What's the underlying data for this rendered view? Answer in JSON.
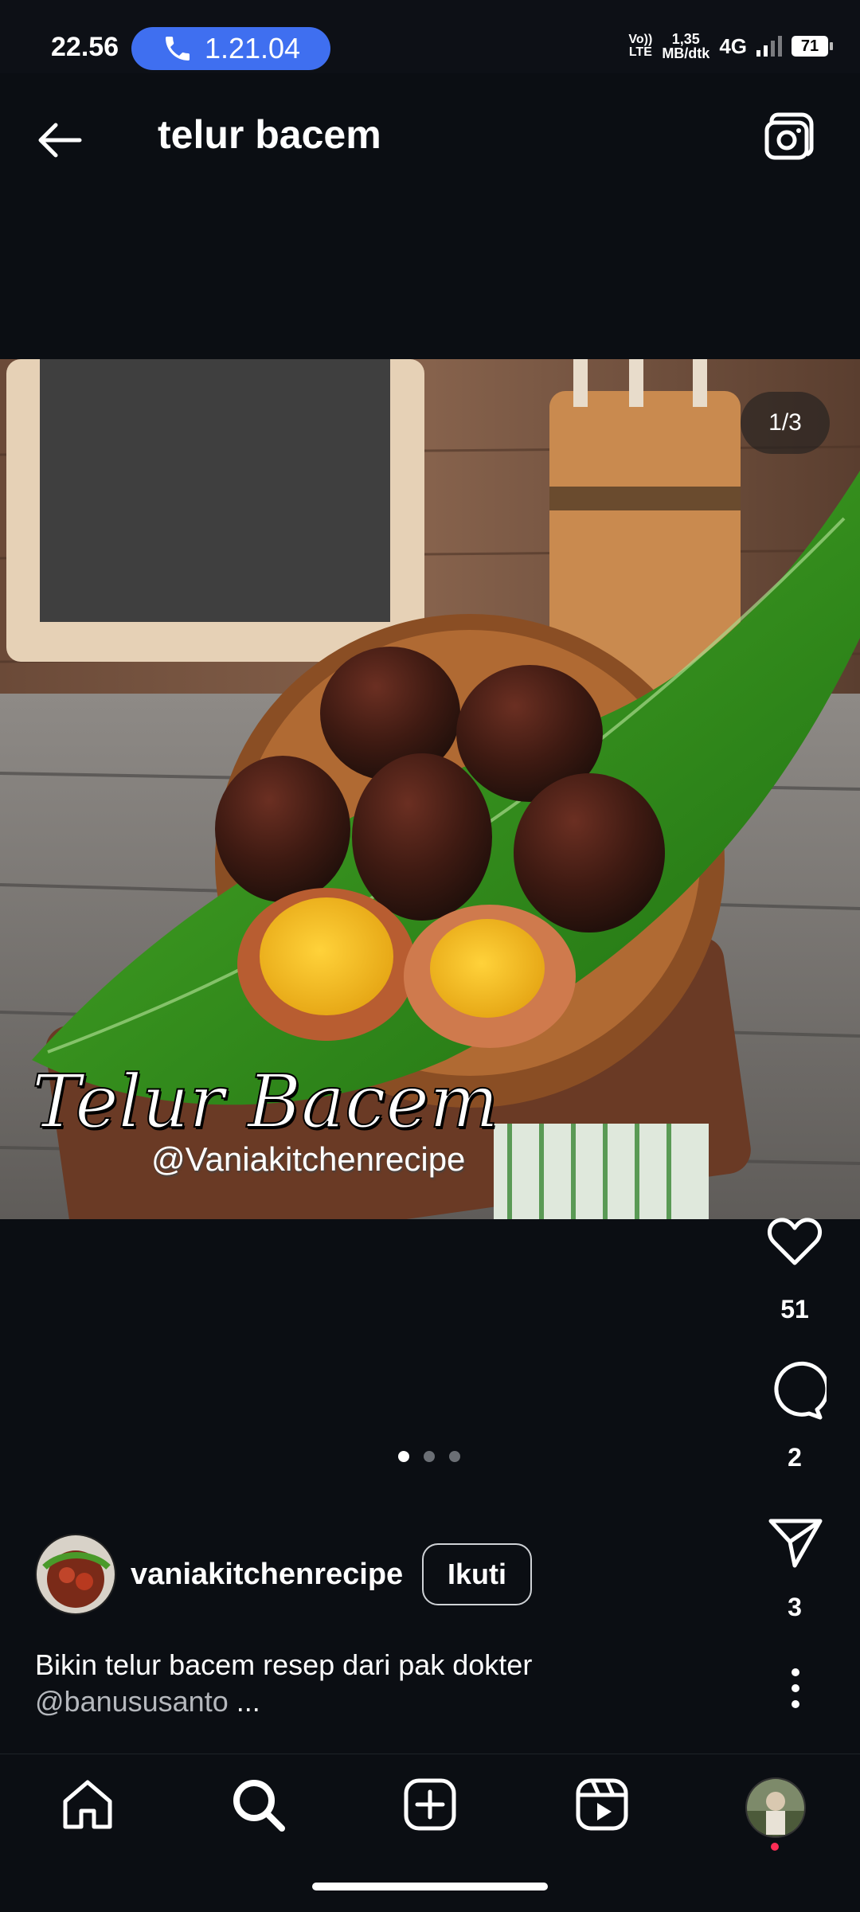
{
  "status_bar": {
    "time": "22.56",
    "call_duration": "1.21.04",
    "volte_top": "Vo))",
    "volte_bottom": "LTE",
    "speed_value": "1,35",
    "speed_unit": "MB/dtk",
    "network": "4G",
    "battery": "71"
  },
  "header": {
    "title": "telur bacem",
    "back_icon": "arrow-left-icon",
    "camera_icon": "camera-icon"
  },
  "post": {
    "photo_counter": "1/3",
    "watermark_title": "Telur Bacem",
    "watermark_handle": "@Vaniakitchenrecipe",
    "dots_total": 3,
    "dots_active": 0,
    "likes": "51",
    "comments": "2",
    "shares": "3",
    "author": "vaniakitchenrecipe",
    "follow_label": "Ikuti",
    "caption_text": "Bikin telur bacem resep dari pak dokter",
    "caption_mention": "@banususanto",
    "caption_more": " ..."
  },
  "bottom_nav": {
    "items": [
      "home-icon",
      "search-icon",
      "create-icon",
      "reels-icon",
      "profile-avatar"
    ]
  },
  "colors": {
    "background": "#0b0e13",
    "call_pill": "#3f6ff0",
    "notification_dot": "#ff2d55"
  }
}
